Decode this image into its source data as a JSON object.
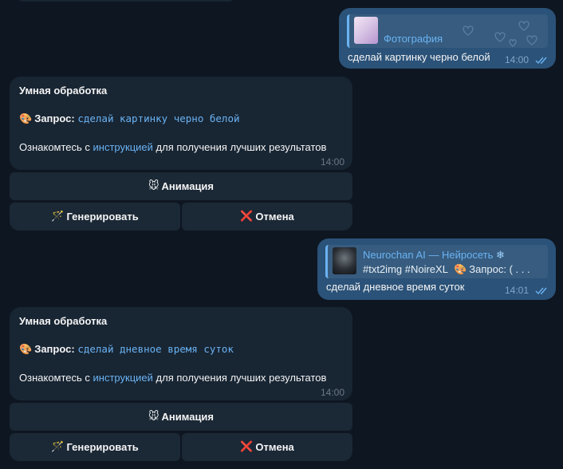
{
  "colors": {
    "background": "#0e1621",
    "outgoing_bubble": "#2b5278",
    "incoming_bubble": "#182533",
    "accent": "#6ab3f3",
    "button": "#1b2836"
  },
  "messages": [
    {
      "direction": "outgoing",
      "reply": {
        "title": "Фотография",
        "thumb_icon": "anime-photo-thumb"
      },
      "text": "сделай картинку черно белой",
      "time": "14:00",
      "status": "read"
    },
    {
      "direction": "incoming",
      "heading": "Умная обработка",
      "query_label": "Запрос:",
      "query_value": "сделай картинку черно белой",
      "info_prefix": "Ознакомтесь с ",
      "info_link": "инструкцией",
      "info_suffix": " для получения лучших результатов",
      "time": "14:00",
      "buttons": {
        "animation": "Анимация",
        "generate": "Генерировать",
        "cancel": "Отмена"
      }
    },
    {
      "direction": "outgoing",
      "reply": {
        "title": "Neurochan AI — Нейросеть",
        "text_tag": "#txt2img #NoireXL",
        "text_query": "Запрос: ( . . .",
        "thumb_icon": "dark-portrait-thumb"
      },
      "text": "сделай дневное время суток",
      "time": "14:01",
      "status": "read"
    },
    {
      "direction": "incoming",
      "heading": "Умная обработка",
      "query_label": "Запрос:",
      "query_value": "сделай дневное время суток",
      "info_prefix": "Ознакомтесь с ",
      "info_link": "инструкцией",
      "info_suffix": " для получения лучших результатов",
      "time": "14:00",
      "buttons": {
        "animation": "Анимация",
        "generate": "Генерировать",
        "cancel": "Отмена"
      }
    }
  ]
}
